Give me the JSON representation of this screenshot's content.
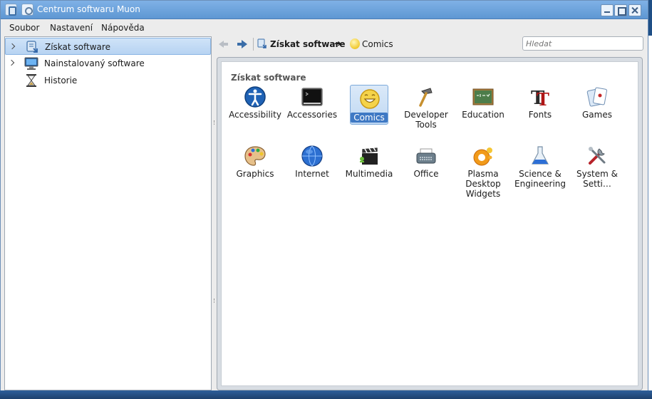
{
  "window": {
    "title": "Centrum softwaru Muon"
  },
  "menubar": {
    "items": [
      "Soubor",
      "Nastavení",
      "Nápověda"
    ]
  },
  "sidebar": {
    "items": [
      {
        "label": "Získat software",
        "selected": true,
        "expandable": true,
        "icon": "get-software-icon"
      },
      {
        "label": "Nainstalovaný software",
        "selected": false,
        "expandable": true,
        "icon": "monitor-icon"
      },
      {
        "label": "Historie",
        "selected": false,
        "expandable": false,
        "icon": "hourglass-icon"
      }
    ]
  },
  "breadcrumb": {
    "root": "Získat software",
    "separator": "➜",
    "current": "Comics"
  },
  "search": {
    "placeholder": "Hledat",
    "value": ""
  },
  "main": {
    "section_title": "Získat software",
    "selected": "Comics",
    "categories": [
      {
        "label": "Accessibility",
        "icon": "accessibility-icon"
      },
      {
        "label": "Accessories",
        "icon": "terminal-icon"
      },
      {
        "label": "Comics",
        "icon": "smiley-icon"
      },
      {
        "label": "Developer Tools",
        "icon": "hammer-icon"
      },
      {
        "label": "Education",
        "icon": "chalkboard-icon"
      },
      {
        "label": "Fonts",
        "icon": "font-icon"
      },
      {
        "label": "Games",
        "icon": "cards-icon"
      },
      {
        "label": "Graphics",
        "icon": "palette-icon"
      },
      {
        "label": "Internet",
        "icon": "globe-icon"
      },
      {
        "label": "Multimedia",
        "icon": "clapperboard-icon"
      },
      {
        "label": "Office",
        "icon": "typewriter-icon"
      },
      {
        "label": "Plasma Desktop Widgets",
        "icon": "plasma-icon"
      },
      {
        "label": "Science & Engineering",
        "icon": "flask-icon"
      },
      {
        "label": "System & Setti…",
        "icon": "tools-icon"
      }
    ]
  },
  "colors": {
    "titlebar": "#6aa2dd",
    "selection": "#3f79c4",
    "background": "#ececec"
  }
}
